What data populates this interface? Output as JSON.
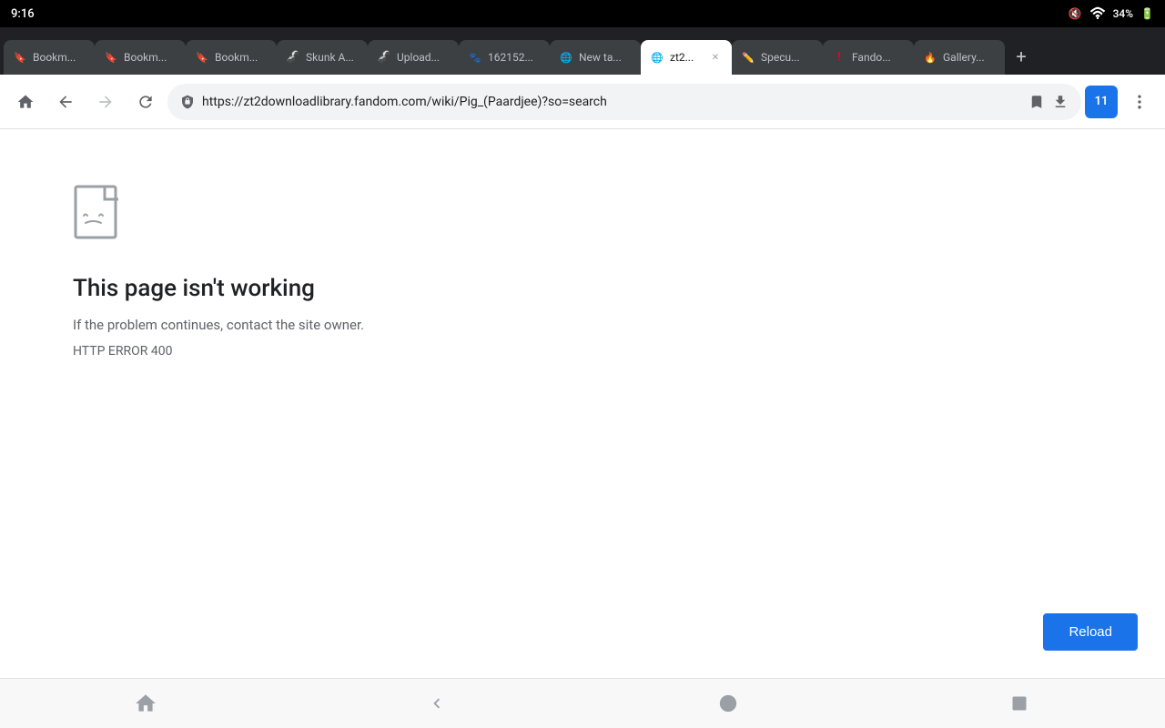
{
  "status_bar": {
    "time": "9:16",
    "mute_icon": "mute",
    "wifi_icon": "wifi",
    "battery": "34%"
  },
  "tabs": [
    {
      "id": "tab1",
      "label": "Bookm...",
      "icon": "bookmark",
      "active": false,
      "closeable": false
    },
    {
      "id": "tab2",
      "label": "Bookm...",
      "icon": "bookmark",
      "active": false,
      "closeable": false
    },
    {
      "id": "tab3",
      "label": "Bookm...",
      "icon": "bookmark",
      "active": false,
      "closeable": false
    },
    {
      "id": "tab4",
      "label": "Skunk A...",
      "icon": "skunk",
      "active": false,
      "closeable": false
    },
    {
      "id": "tab5",
      "label": "Upload...",
      "icon": "upload",
      "active": false,
      "closeable": false
    },
    {
      "id": "tab6",
      "label": "162152...",
      "icon": "paw",
      "active": false,
      "closeable": false
    },
    {
      "id": "tab7",
      "label": "New ta...",
      "icon": "earth",
      "active": false,
      "closeable": false
    },
    {
      "id": "tab8",
      "label": "zt2...",
      "icon": "earth",
      "active": true,
      "closeable": true
    },
    {
      "id": "tab9",
      "label": "Specu...",
      "icon": "pencil",
      "active": false,
      "closeable": false
    },
    {
      "id": "tab10",
      "label": "Fando...",
      "icon": "fandom",
      "active": false,
      "closeable": false
    },
    {
      "id": "tab11",
      "label": "Gallery...",
      "icon": "fire",
      "active": false,
      "closeable": false
    }
  ],
  "address_bar": {
    "url": "https://zt2downloadlibrary.fandom.com/wiki/Pig_(Paardjee)?so=search",
    "security_icon": "info",
    "bookmark_icon": "star",
    "download_icon": "download",
    "extensions_count": "11",
    "menu_icon": "more-vert"
  },
  "page": {
    "error_title": "This page isn't working",
    "error_description": "If the problem continues, contact the site owner.",
    "error_code": "HTTP ERROR 400",
    "reload_label": "Reload"
  },
  "bottom_nav": {
    "home_icon": "home",
    "back_icon": "back",
    "circle_icon": "circle",
    "square_icon": "square"
  }
}
